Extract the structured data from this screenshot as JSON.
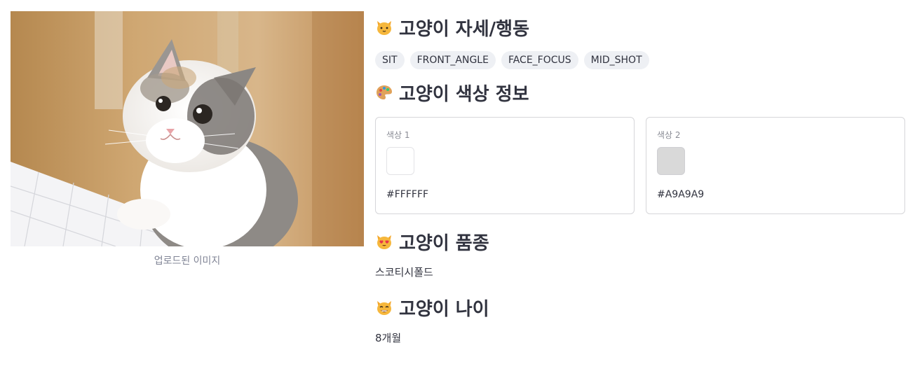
{
  "image": {
    "caption": "업로드된 이미지"
  },
  "pose": {
    "title": "고양이 자세/행동",
    "icon": "cat-face-icon",
    "tags": [
      "SIT",
      "FRONT_ANGLE",
      "FACE_FOCUS",
      "MID_SHOT"
    ]
  },
  "colors": {
    "title": "고양이 색상 정보",
    "icon": "palette-icon",
    "items": [
      {
        "label": "색상 1",
        "hex": "#FFFFFF",
        "swatch": "#FFFFFF"
      },
      {
        "label": "색상 2",
        "hex": "#A9A9A9",
        "swatch": "#D9D9D9"
      }
    ]
  },
  "breed": {
    "title": "고양이 품종",
    "icon": "heart-eyes-cat-icon",
    "value": "스코티시폴드"
  },
  "age": {
    "title": "고양이 나이",
    "icon": "grinning-cat-icon",
    "value": "8개월"
  }
}
